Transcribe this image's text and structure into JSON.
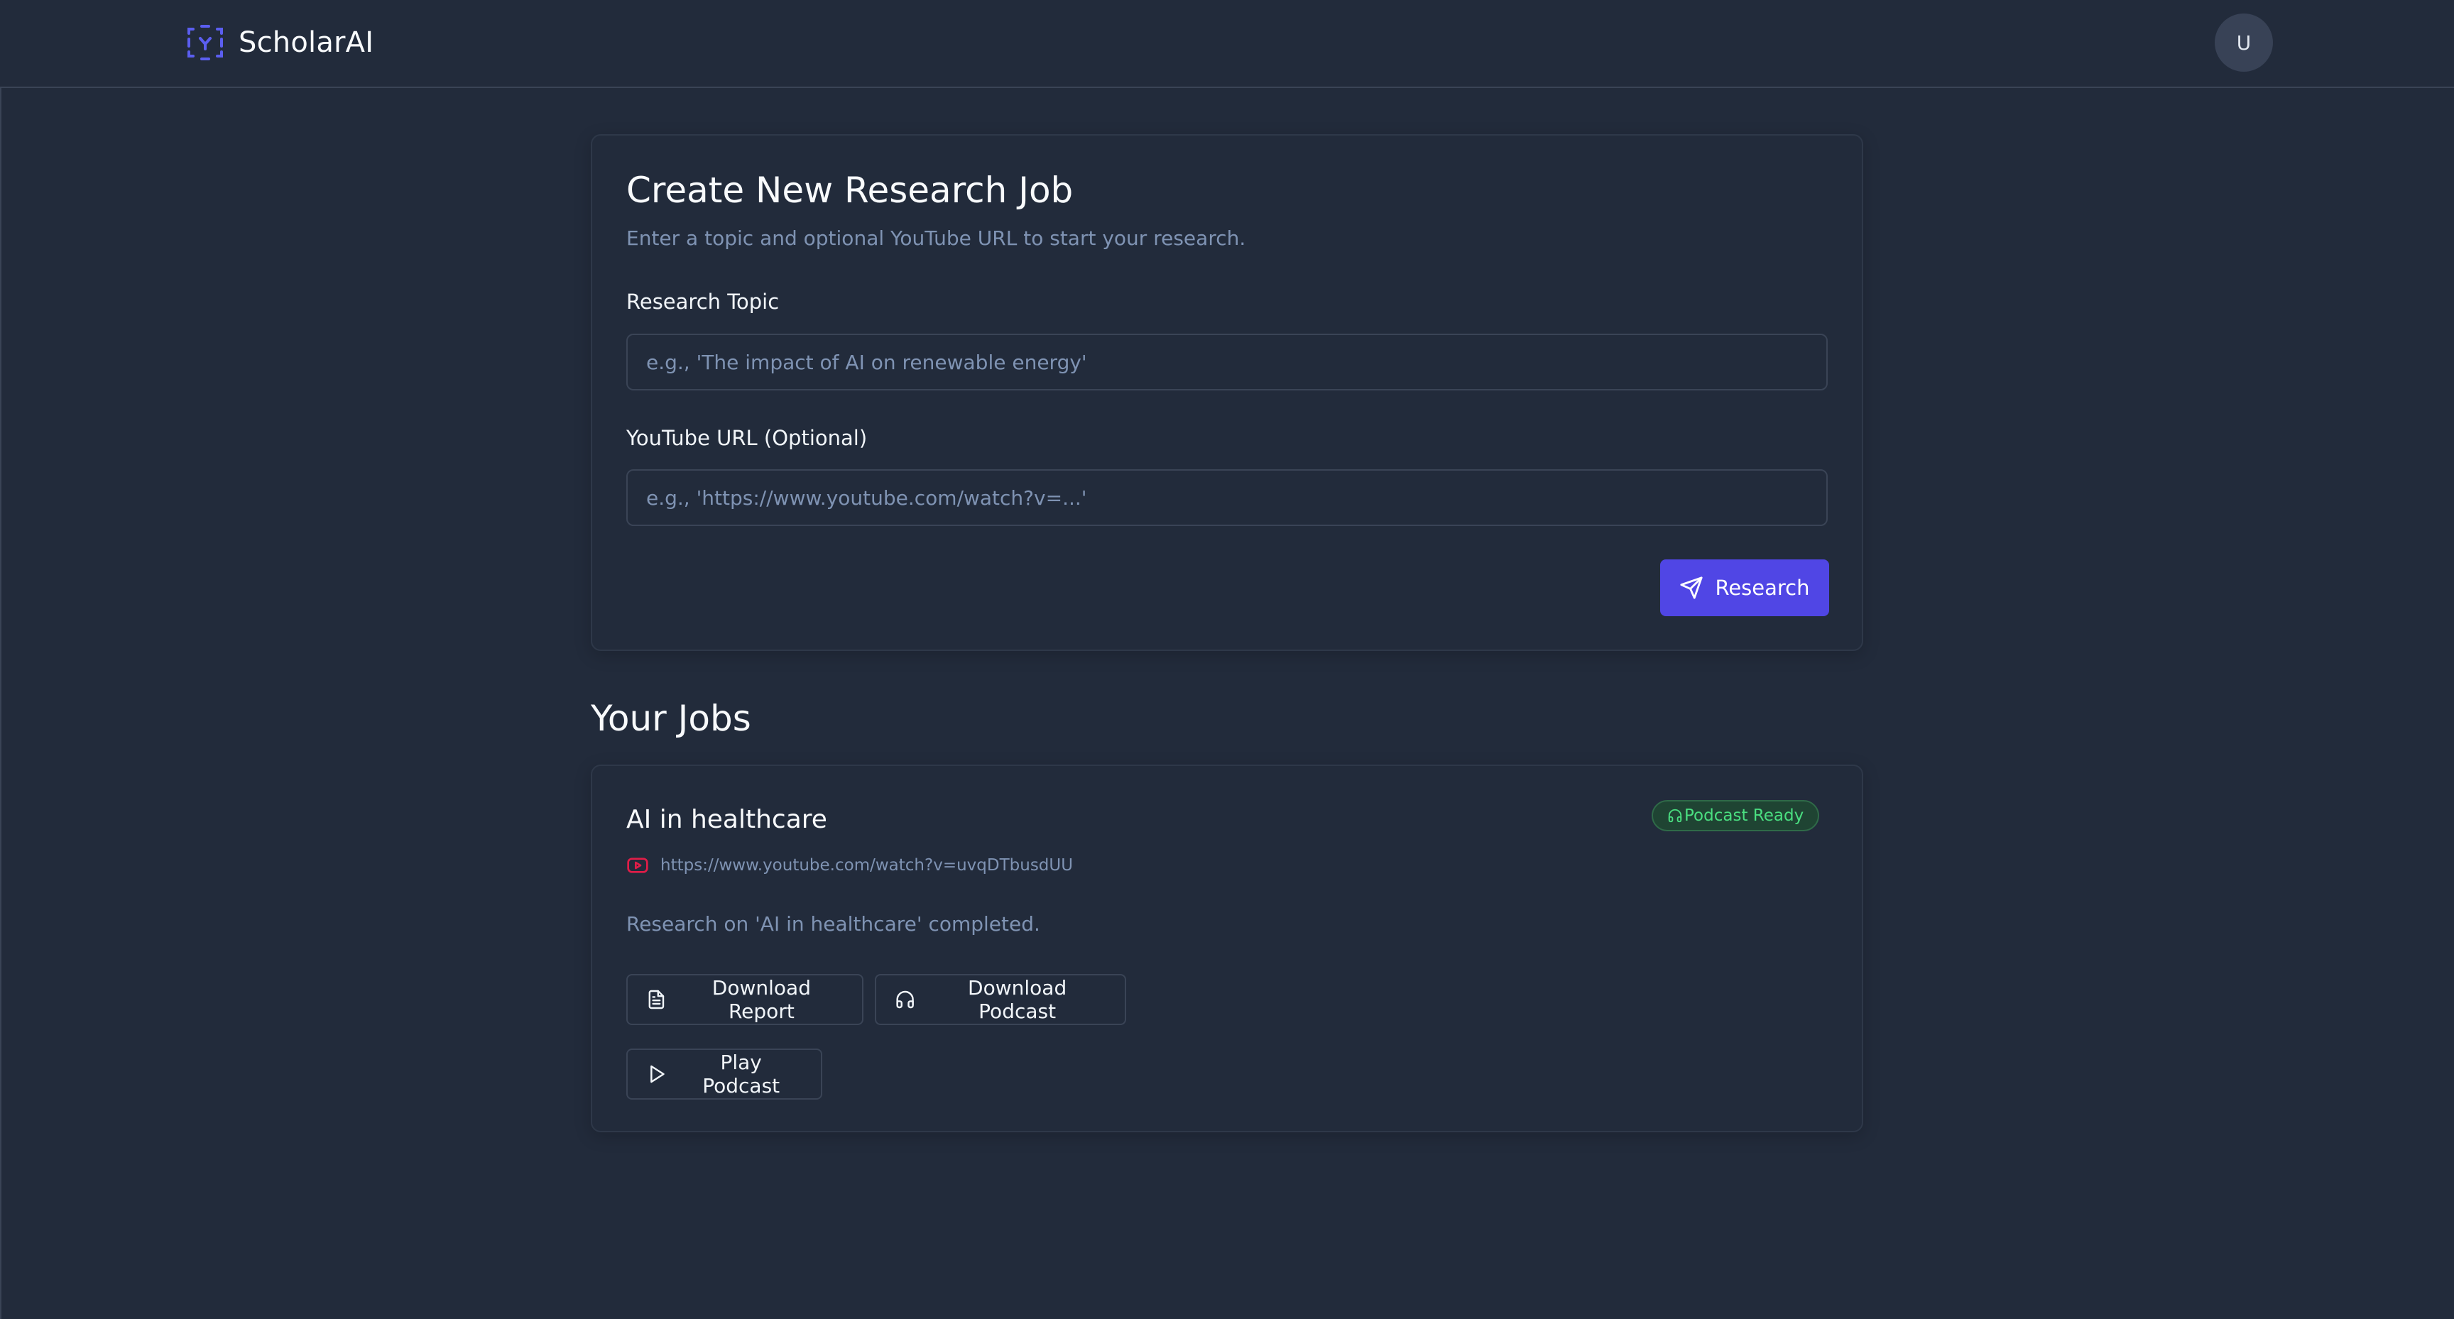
{
  "app": {
    "name": "ScholarAI",
    "user_initial": "U"
  },
  "create_job": {
    "title": "Create New Research Job",
    "subtitle": "Enter a topic and optional YouTube URL to start your research.",
    "topic_label": "Research Topic",
    "topic_placeholder": "e.g., 'The impact of AI on renewable energy'",
    "topic_value": "",
    "url_label": "YouTube URL (Optional)",
    "url_placeholder": "e.g., 'https://www.youtube.com/watch?v=...'",
    "url_value": "",
    "submit_label": "Research",
    "submit_icon": "send-icon"
  },
  "jobs": {
    "heading": "Your Jobs",
    "items": [
      {
        "title": "AI in healthcare",
        "badge": "Podcast Ready",
        "badge_icon": "headphones-icon",
        "youtube_url": "https://www.youtube.com/watch?v=uvqDTbusdUU",
        "status_text": "Research on 'AI in healthcare' completed.",
        "actions": {
          "download_report": "Download Report",
          "download_podcast": "Download Podcast",
          "play_podcast": "Play Podcast"
        }
      }
    ]
  },
  "colors": {
    "background": "#222b3b",
    "accent": "#5046e5",
    "muted_text": "#7f93b3",
    "success": "#4ade80",
    "youtube_red": "#e11d48"
  }
}
